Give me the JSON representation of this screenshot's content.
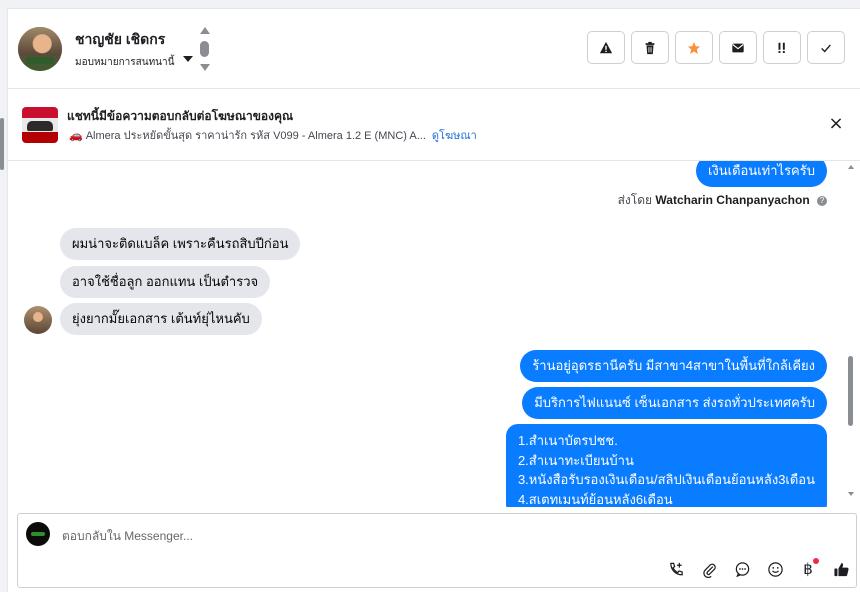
{
  "header": {
    "contact_name": "ชาญชัย เชิดกร",
    "assign_label": "มอบหมายการสนทนานี้",
    "actions": [
      {
        "icon": "warning-icon",
        "glyph": "⚠"
      },
      {
        "icon": "trash-icon",
        "glyph": "🗑"
      },
      {
        "icon": "star-icon",
        "glyph": "★",
        "color": "#f7923b"
      },
      {
        "icon": "mail-icon",
        "glyph": "✉"
      },
      {
        "icon": "follow-up-icon",
        "glyph": "!!"
      },
      {
        "icon": "check-icon",
        "glyph": "✓"
      }
    ]
  },
  "ad": {
    "title": "แชทนี้มีข้อความตอบกลับต่อโฆษณาของคุณ",
    "subtitle": "Almera ประหยัดขั้นสุด ราคาน่ารัก รหัส V099 - Almera 1.2 E (MNC) A...",
    "link": "ดูโฆษณา",
    "close": "×"
  },
  "messages": {
    "top_out": "เงินเดือนเท่าไรครับ",
    "sent_by_prefix": "ส่งโดย",
    "sent_by_name": "Watcharin Chanpanyachon",
    "incoming": [
      "ผมน่าจะติดแบล็ค เพราะคืนรถสิบปีก่อน",
      "อาจใช้ชื่อลูก ออกแทน เป็นตำรวจ",
      "ยุ่งยากมั๊ยเอกสาร เต้นท์ยุ่ไหนคับ"
    ],
    "outgoing": [
      "ร้านอยู่อุดรธานีครับ มีสาขา4สาขาในพื้นที่ใกล้เคียง",
      "มีบริการไฟแนนซ์ เซ็นเอกสาร ส่งรถทั่วประเทศครับ"
    ],
    "doc_list": [
      "1.สำเนาบัตรปชช.",
      "2.สำเนาทะเบียนบ้าน",
      "3.หนังสือรับรองเงินเดือน/สลิปเงินเดือนย้อนหลัง3เดือน",
      "4.สเตทเมนท์ย้อนหลัง6เดือน"
    ]
  },
  "composer": {
    "placeholder": "ตอบกลับใน Messenger...",
    "tools": [
      "call-add-icon",
      "attachment-icon",
      "saved-reply-icon",
      "emoji-icon",
      "payment-icon",
      "like-icon"
    ]
  },
  "colors": {
    "outgoing_bubble": "#0a7cff",
    "incoming_bubble": "#e4e6eb",
    "star": "#f7923b",
    "link": "#216fdb"
  }
}
